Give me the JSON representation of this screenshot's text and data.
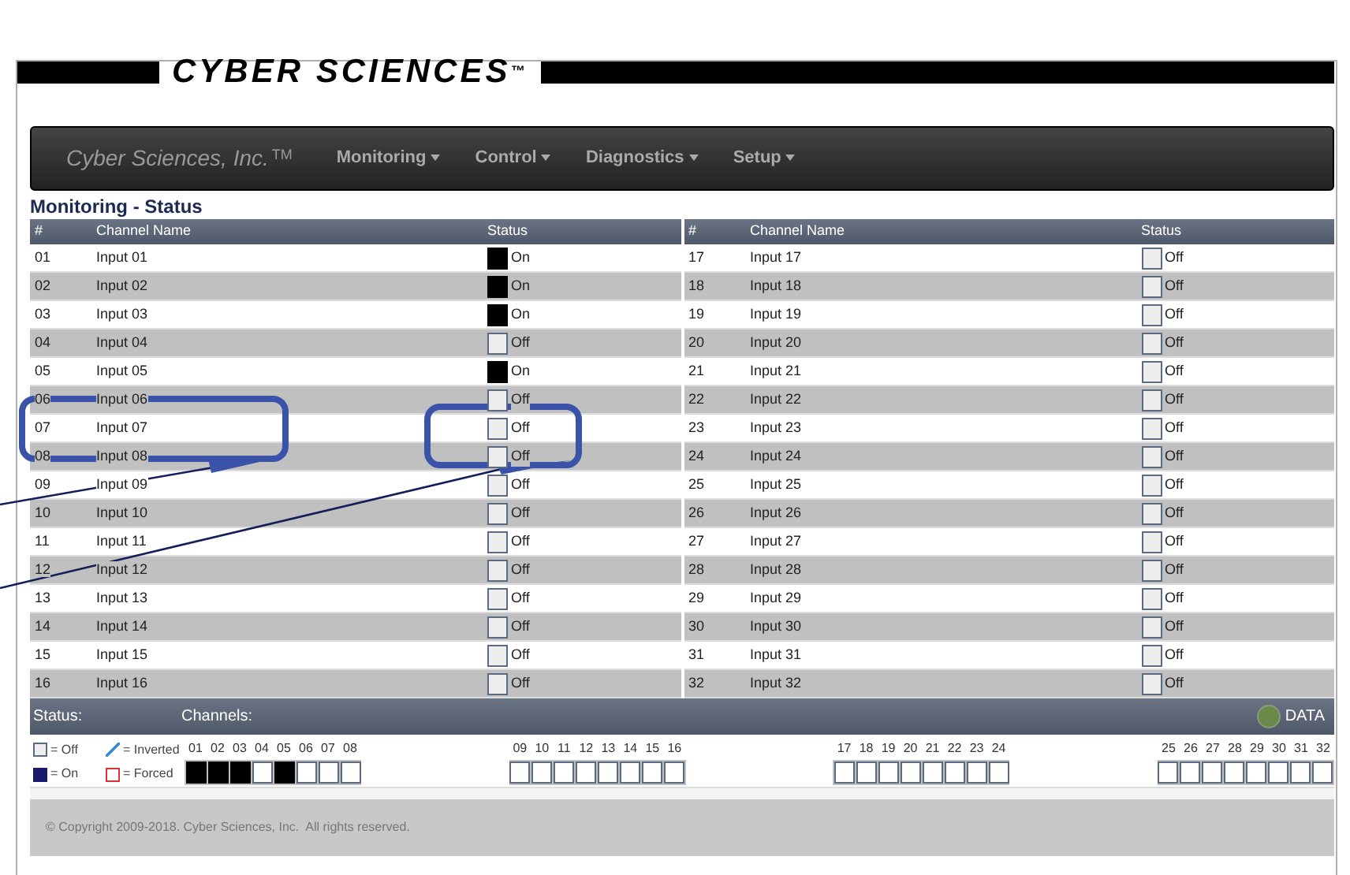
{
  "logo": {
    "text": "CYBER SCIENCES",
    "mark": "™"
  },
  "navbar": {
    "brand": "Cyber Sciences, Inc.",
    "brand_mark": "TM",
    "menus": [
      {
        "label": "Monitoring"
      },
      {
        "label": "Control"
      },
      {
        "label": "Diagnostics"
      },
      {
        "label": "Setup"
      }
    ]
  },
  "page_title": "Monitoring - Status",
  "table": {
    "columns_left": [
      "#",
      "Channel Name",
      "Status"
    ],
    "columns_right": [
      "#",
      "Channel Name",
      "Status"
    ],
    "rows": [
      {
        "number": "01",
        "name": "Input 01",
        "on": true,
        "status": "On"
      },
      {
        "number": "02",
        "name": "Input 02",
        "on": true,
        "status": "On"
      },
      {
        "number": "03",
        "name": "Input 03",
        "on": true,
        "status": "On"
      },
      {
        "number": "04",
        "name": "Input 04",
        "on": false,
        "status": "Off"
      },
      {
        "number": "05",
        "name": "Input 05",
        "on": true,
        "status": "On"
      },
      {
        "number": "06",
        "name": "Input 06",
        "on": false,
        "status": "Off"
      },
      {
        "number": "07",
        "name": "Input 07",
        "on": false,
        "status": "Off"
      },
      {
        "number": "08",
        "name": "Input 08",
        "on": false,
        "status": "Off"
      },
      {
        "number": "09",
        "name": "Input 09",
        "on": false,
        "status": "Off"
      },
      {
        "number": "10",
        "name": "Input 10",
        "on": false,
        "status": "Off"
      },
      {
        "number": "11",
        "name": "Input 11",
        "on": false,
        "status": "Off"
      },
      {
        "number": "12",
        "name": "Input 12",
        "on": false,
        "status": "Off"
      },
      {
        "number": "13",
        "name": "Input 13",
        "on": false,
        "status": "Off"
      },
      {
        "number": "14",
        "name": "Input 14",
        "on": false,
        "status": "Off"
      },
      {
        "number": "15",
        "name": "Input 15",
        "on": false,
        "status": "Off"
      },
      {
        "number": "16",
        "name": "Input 16",
        "on": false,
        "status": "Off"
      },
      {
        "number": "17",
        "name": "Input 17",
        "on": false,
        "status": "Off"
      },
      {
        "number": "18",
        "name": "Input 18",
        "on": false,
        "status": "Off"
      },
      {
        "number": "19",
        "name": "Input 19",
        "on": false,
        "status": "Off"
      },
      {
        "number": "20",
        "name": "Input 20",
        "on": false,
        "status": "Off"
      },
      {
        "number": "21",
        "name": "Input 21",
        "on": false,
        "status": "Off"
      },
      {
        "number": "22",
        "name": "Input 22",
        "on": false,
        "status": "Off"
      },
      {
        "number": "23",
        "name": "Input 23",
        "on": false,
        "status": "Off"
      },
      {
        "number": "24",
        "name": "Input 24",
        "on": false,
        "status": "Off"
      },
      {
        "number": "25",
        "name": "Input 25",
        "on": false,
        "status": "Off"
      },
      {
        "number": "26",
        "name": "Input 26",
        "on": false,
        "status": "Off"
      },
      {
        "number": "27",
        "name": "Input 27",
        "on": false,
        "status": "Off"
      },
      {
        "number": "28",
        "name": "Input 28",
        "on": false,
        "status": "Off"
      },
      {
        "number": "29",
        "name": "Input 29",
        "on": false,
        "status": "Off"
      },
      {
        "number": "30",
        "name": "Input 30",
        "on": false,
        "status": "Off"
      },
      {
        "number": "31",
        "name": "Input 31",
        "on": false,
        "status": "Off"
      },
      {
        "number": "32",
        "name": "Input 32",
        "on": false,
        "status": "Off"
      }
    ]
  },
  "status_panel": {
    "status_label": "Status:",
    "channels_label": "Channels:",
    "data_label": "DATA",
    "legend": [
      {
        "kind": "off",
        "label": "= Off"
      },
      {
        "kind": "inverted",
        "label": "= Inverted"
      },
      {
        "kind": "on",
        "label": "= On"
      },
      {
        "kind": "forced",
        "label": "= Forced"
      }
    ],
    "channels": [
      {
        "label": "01",
        "on": true
      },
      {
        "label": "02",
        "on": true
      },
      {
        "label": "03",
        "on": true
      },
      {
        "label": "04",
        "on": false
      },
      {
        "label": "05",
        "on": true
      },
      {
        "label": "06",
        "on": false
      },
      {
        "label": "07",
        "on": false
      },
      {
        "label": "08",
        "on": false
      },
      {
        "label": "09",
        "on": false
      },
      {
        "label": "10",
        "on": false
      },
      {
        "label": "11",
        "on": false
      },
      {
        "label": "12",
        "on": false
      },
      {
        "label": "13",
        "on": false
      },
      {
        "label": "14",
        "on": false
      },
      {
        "label": "15",
        "on": false
      },
      {
        "label": "16",
        "on": false
      },
      {
        "label": "17",
        "on": false
      },
      {
        "label": "18",
        "on": false
      },
      {
        "label": "19",
        "on": false
      },
      {
        "label": "20",
        "on": false
      },
      {
        "label": "21",
        "on": false
      },
      {
        "label": "22",
        "on": false
      },
      {
        "label": "23",
        "on": false
      },
      {
        "label": "24",
        "on": false
      },
      {
        "label": "25",
        "on": false
      },
      {
        "label": "26",
        "on": false
      },
      {
        "label": "27",
        "on": false
      },
      {
        "label": "28",
        "on": false
      },
      {
        "label": "29",
        "on": false
      },
      {
        "label": "30",
        "on": false
      },
      {
        "label": "31",
        "on": false
      },
      {
        "label": "32",
        "on": false
      }
    ]
  },
  "footer": "© Copyright 2009-2018. Cyber Sciences, Inc.  All rights reserved."
}
